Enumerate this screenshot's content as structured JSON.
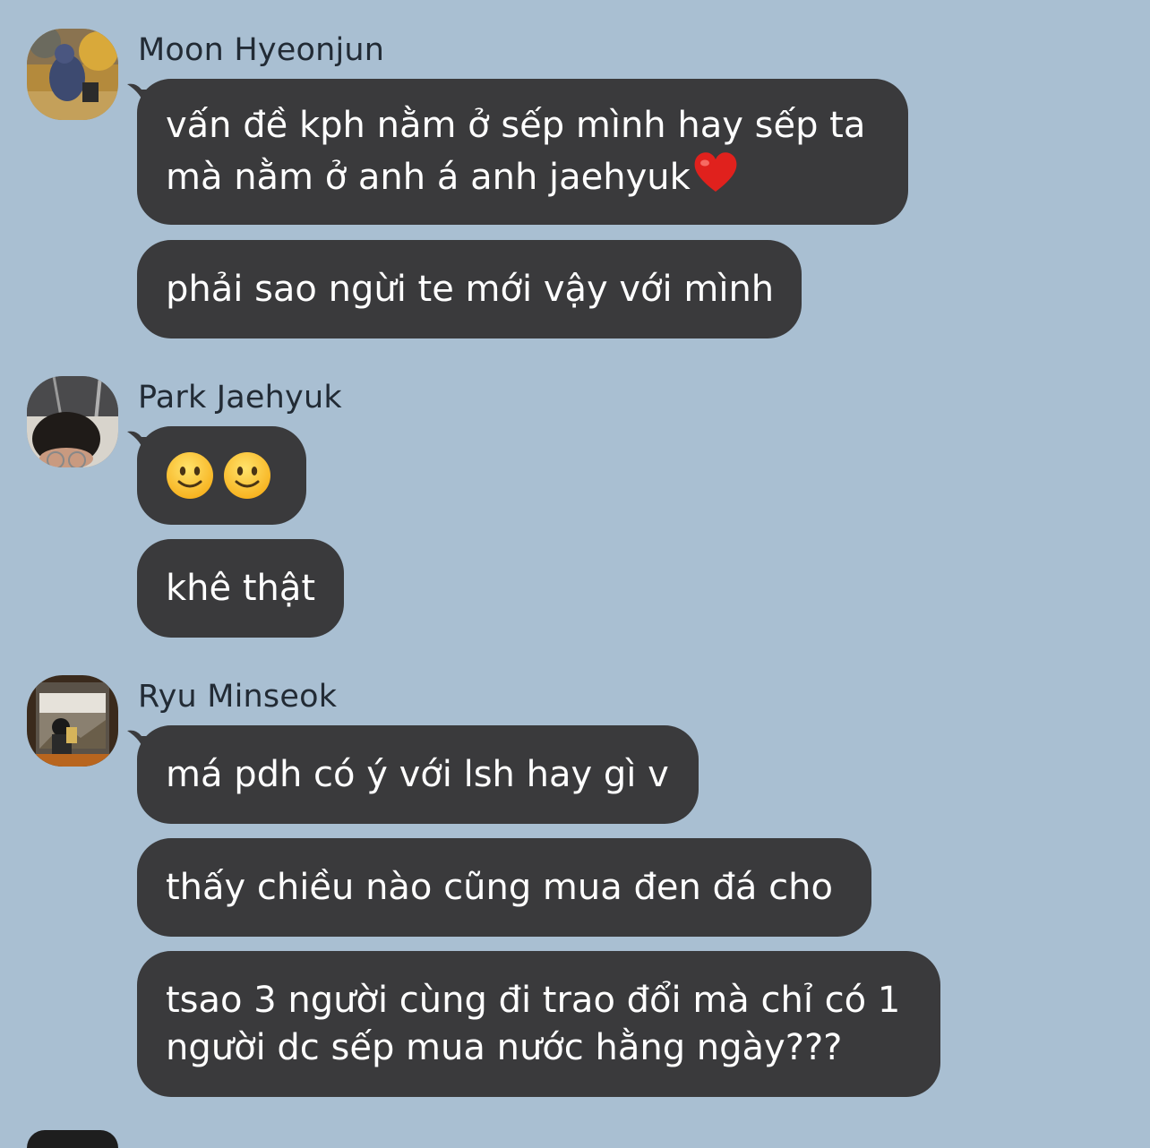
{
  "chat": {
    "groups": [
      {
        "sender": "Moon Hyeonjun",
        "messages": [
          {
            "lines": [
              "vấn đề kph nằm ở sếp mình hay sếp ta",
              "mà nằm ở anh á anh jaehyuk"
            ],
            "trailing_emoji": "heart-icon"
          },
          {
            "lines": [
              "phải sao ngừi te mới vậy với mình"
            ]
          }
        ]
      },
      {
        "sender": "Park Jaehyuk",
        "messages": [
          {
            "emojis": [
              "slightly-smiling-face-icon",
              "slightly-smiling-face-icon"
            ]
          },
          {
            "lines": [
              "khê thật"
            ]
          }
        ]
      },
      {
        "sender": "Ryu Minseok",
        "messages": [
          {
            "lines": [
              "má pdh có ý với lsh hay gì v"
            ]
          },
          {
            "lines": [
              "thấy chiều nào cũng mua đen đá cho"
            ]
          },
          {
            "lines": [
              "tsao 3 người cùng đi trao đổi mà chỉ có 1",
              "người dc sếp mua nước hằng ngày???"
            ]
          }
        ]
      }
    ]
  },
  "colors": {
    "background": "#a9bfd2",
    "bubble": "#3a3a3c",
    "bubble_text": "#ffffff",
    "sender_text": "#222b35"
  }
}
